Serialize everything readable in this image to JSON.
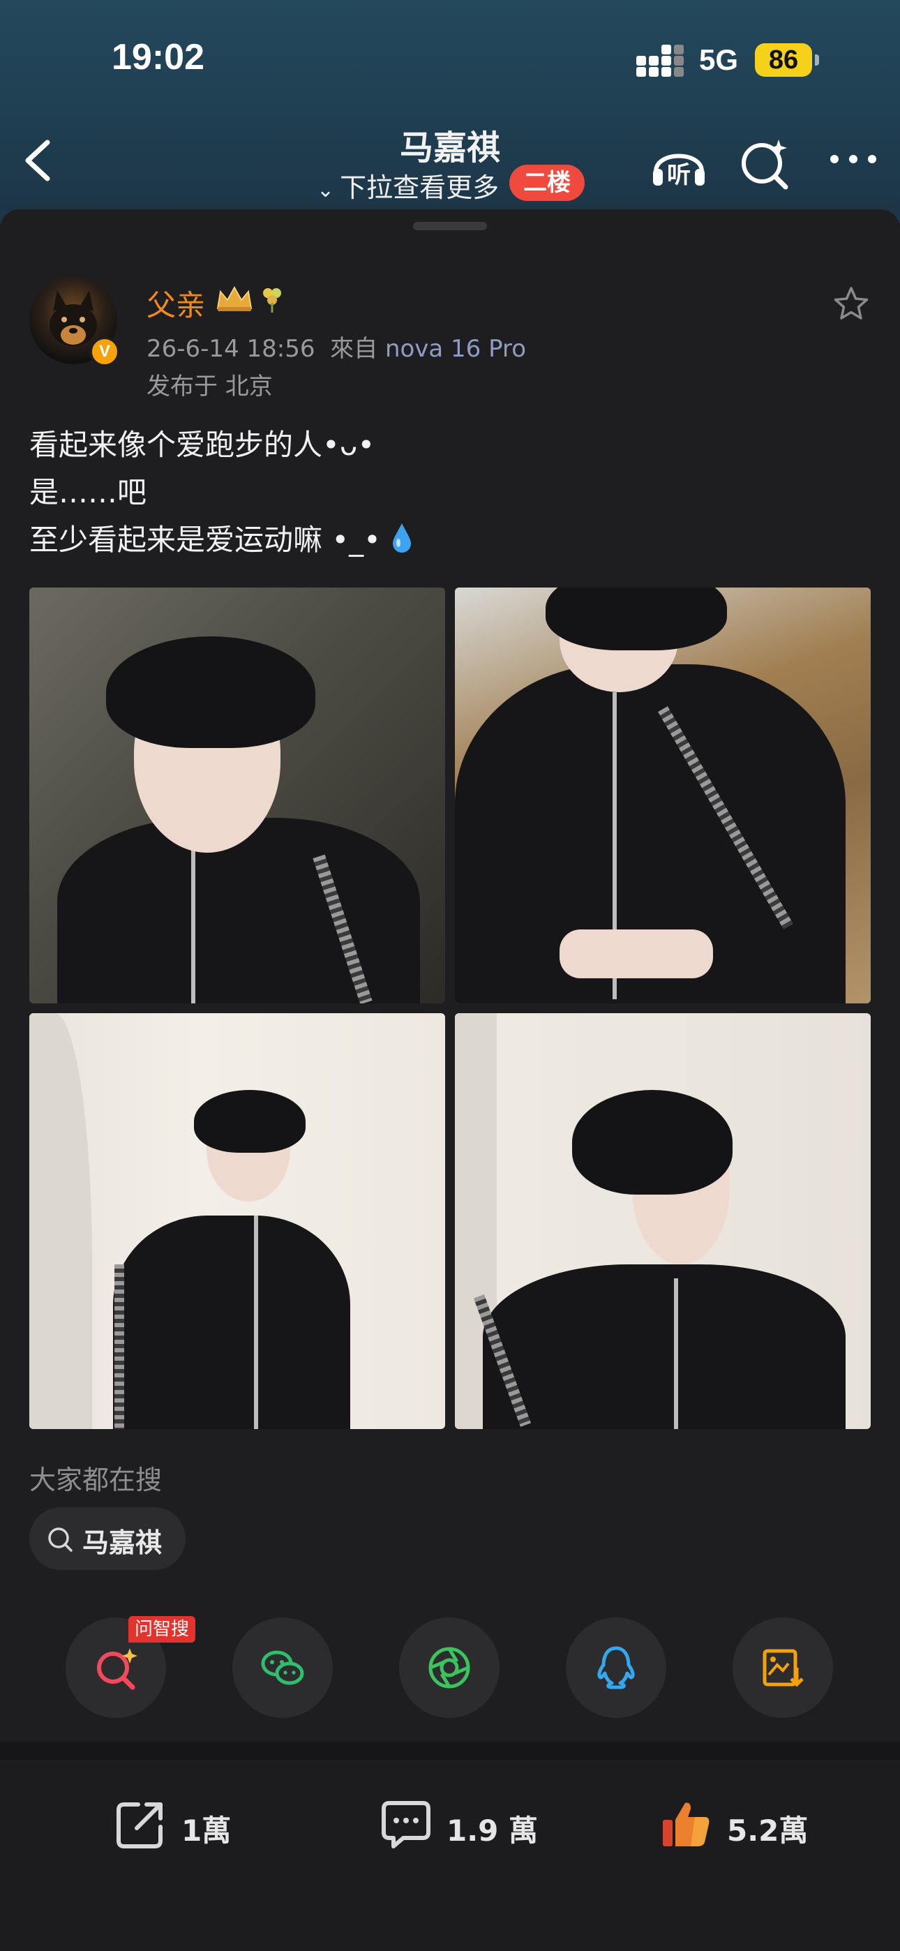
{
  "status_bar": {
    "time": "19:02",
    "network": "5G",
    "battery": "86"
  },
  "header": {
    "title": "马嘉祺",
    "subtitle": "下拉查看更多",
    "floor_tag": "二楼",
    "listen_icon_label": "听"
  },
  "post": {
    "author": "父亲",
    "timestamp": "26-6-14 18:56",
    "source_prefix": "來自",
    "device": "nova 16 Pro",
    "location": "发布于 北京",
    "lines": [
      "看起来像个爱跑步的人•ᴗ•",
      "是……吧",
      "至少看起来是爱运动嘛 •_•"
    ],
    "photos": [
      "photo-1",
      "photo-2",
      "photo-3",
      "photo-4"
    ]
  },
  "search": {
    "label": "大家都在搜",
    "query": "马嘉祺"
  },
  "share_row": {
    "ai_badge": "问智搜",
    "items": [
      "ai-search-icon",
      "wechat-icon",
      "moments-icon",
      "qq-icon",
      "save-image-icon"
    ]
  },
  "actions": {
    "repost_count": "1萬",
    "comment_count": "1.9 萬",
    "like_count": "5.2萬"
  },
  "colors": {
    "header_bg": "#24485c",
    "card_bg": "#1e1e20",
    "username": "#f08a1a",
    "floor_tag": "#f04a3e",
    "battery": "#f5d11a"
  }
}
